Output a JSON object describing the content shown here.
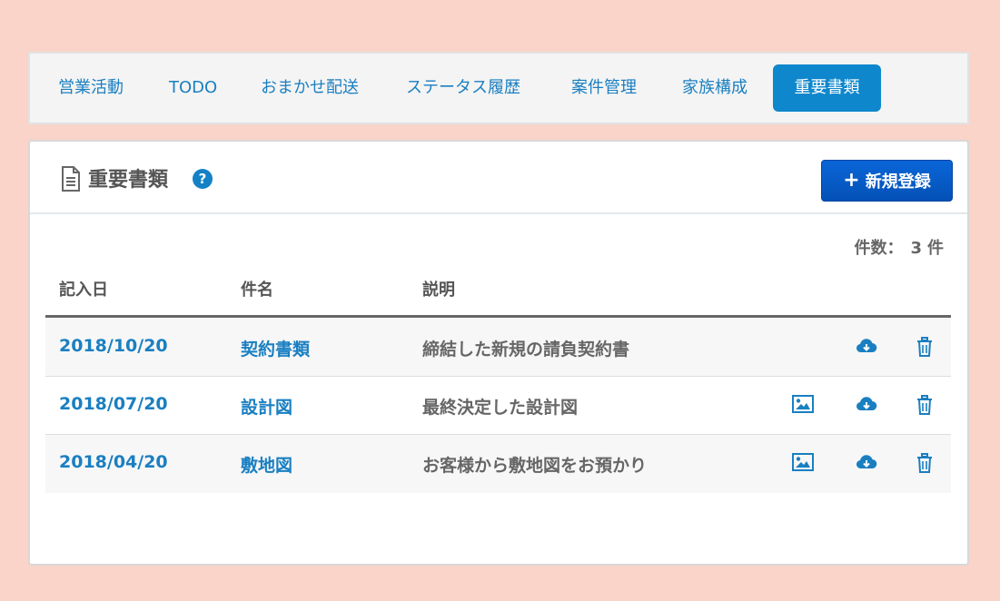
{
  "tabs": [
    {
      "label": "営業活動",
      "active": false
    },
    {
      "label": "TODO",
      "active": false
    },
    {
      "label": "おまかせ配送",
      "active": false
    },
    {
      "label": "ステータス履歴",
      "active": false
    },
    {
      "label": "案件管理",
      "active": false
    },
    {
      "label": "家族構成",
      "active": false
    },
    {
      "label": "重要書類",
      "active": true
    }
  ],
  "panel": {
    "title": "重要書類",
    "title_icon": "document-icon",
    "help_icon": "question-circle-icon",
    "help_glyph": "?",
    "new_button": {
      "icon": "plus-icon",
      "plus": "+",
      "label": "新規登録"
    }
  },
  "count": {
    "label": "件数：",
    "value": "3",
    "unit": "件"
  },
  "table": {
    "columns": [
      "記入日",
      "件名",
      "説明"
    ],
    "rows": [
      {
        "date": "2018/10/20",
        "name": "契約書類",
        "description": "締結した新規の請負契約書",
        "has_image": false
      },
      {
        "date": "2018/07/20",
        "name": "設計図",
        "description": "最終決定した設計図",
        "has_image": true
      },
      {
        "date": "2018/04/20",
        "name": "敷地図",
        "description": "お客様から敷地図をお預かり",
        "has_image": true
      }
    ],
    "row_icons": {
      "image": "image-icon",
      "download": "cloud-download-icon",
      "delete": "trash-icon"
    }
  },
  "colors": {
    "background": "#fad3c9",
    "accent": "#0e87cc",
    "link": "#1a7fc1",
    "button": "#0451b6"
  }
}
